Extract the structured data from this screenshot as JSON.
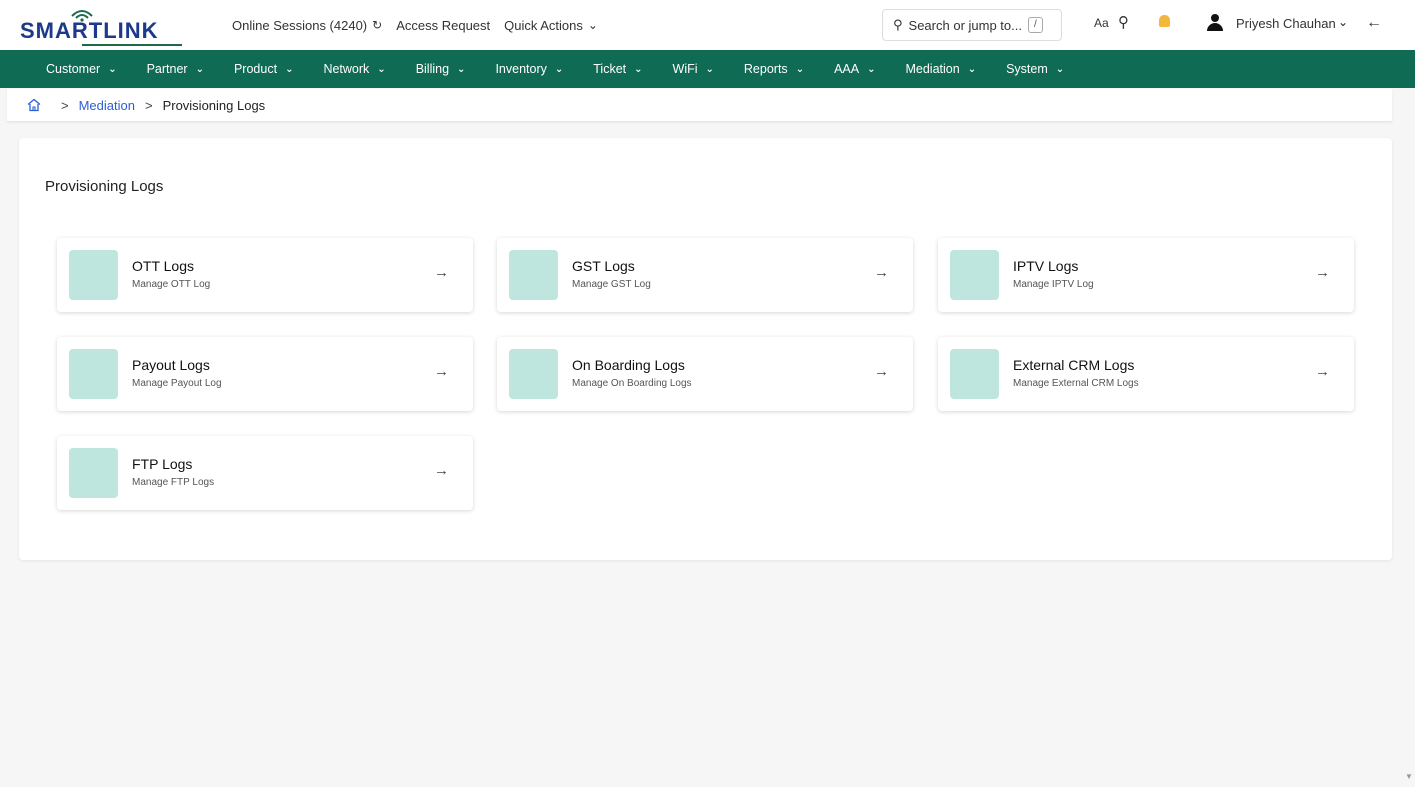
{
  "header": {
    "logo_text": "SMARTLINK",
    "online_sessions": "Online Sessions (4240)",
    "refresh_icon": "refresh-icon",
    "access_request": "Access Request",
    "quick_actions": "Quick Actions",
    "search_placeholder": "Search or jump to...",
    "search_shortcut": "/",
    "font_size_label": "Aa",
    "user_name": "Priyesh Chauhan"
  },
  "nav": {
    "items": [
      "Customer",
      "Partner",
      "Product",
      "Network",
      "Billing",
      "Inventory",
      "Ticket",
      "WiFi",
      "Reports",
      "AAA",
      "Mediation",
      "System"
    ]
  },
  "breadcrumb": {
    "parent": "Mediation",
    "current": "Provisioning Logs"
  },
  "page": {
    "title": "Provisioning Logs"
  },
  "tiles": [
    {
      "title": "OTT Logs",
      "subtitle": "Manage OTT Log"
    },
    {
      "title": "GST Logs",
      "subtitle": "Manage GST Log"
    },
    {
      "title": "IPTV Logs",
      "subtitle": "Manage IPTV Log"
    },
    {
      "title": "Payout Logs",
      "subtitle": "Manage Payout Log"
    },
    {
      "title": "On Boarding Logs",
      "subtitle": "Manage On Boarding Logs"
    },
    {
      "title": "External CRM Logs",
      "subtitle": "Manage External CRM Logs"
    },
    {
      "title": "FTP Logs",
      "subtitle": "Manage FTP Logs"
    }
  ],
  "colors": {
    "nav_bg": "#0f6b53",
    "tile_icon_bg": "#bfe5df",
    "link": "#2b5fd9"
  }
}
